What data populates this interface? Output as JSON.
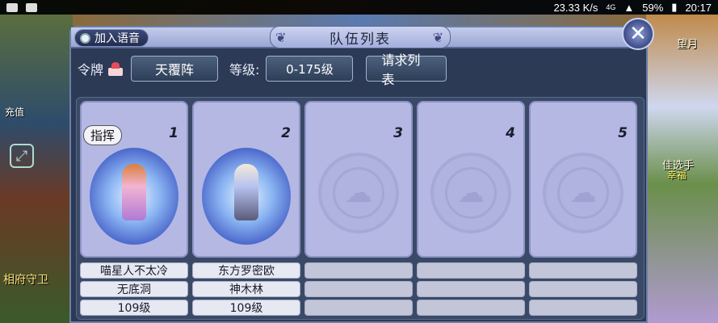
{
  "status_bar": {
    "speed": "23.33 K/s",
    "network": "4G",
    "battery": "59%",
    "time": "20:17"
  },
  "background": {
    "npc_name": "相府守卫",
    "recharge_label": "充值",
    "right_text_1": "望月",
    "right_text_2": "佳选手",
    "right_text_3": "幸福"
  },
  "dialog": {
    "title": "队伍列表",
    "voice_button": "加入语音",
    "close_label": "✕"
  },
  "toolbar": {
    "token_label": "令牌",
    "formation": "天覆阵",
    "level_label": "等级:",
    "level_range": "0-175级",
    "request_button": "请求列表"
  },
  "slots": [
    {
      "number": "1",
      "is_commander": true,
      "commander_label": "指挥",
      "name": "喵星人不太冷",
      "sect": "无底洞",
      "level": "109级",
      "occupied": true
    },
    {
      "number": "2",
      "is_commander": false,
      "name": "东方罗密欧",
      "sect": "神木林",
      "level": "109级",
      "occupied": true
    },
    {
      "number": "3",
      "is_commander": false,
      "name": "",
      "sect": "",
      "level": "",
      "occupied": false
    },
    {
      "number": "4",
      "is_commander": false,
      "name": "",
      "sect": "",
      "level": "",
      "occupied": false
    },
    {
      "number": "5",
      "is_commander": false,
      "name": "",
      "sect": "",
      "level": "",
      "occupied": false
    }
  ],
  "icons": {
    "close": "close-icon",
    "mic": "microphone-icon",
    "token": "cake-icon",
    "empty_slot": "cloud-emblem-icon"
  }
}
